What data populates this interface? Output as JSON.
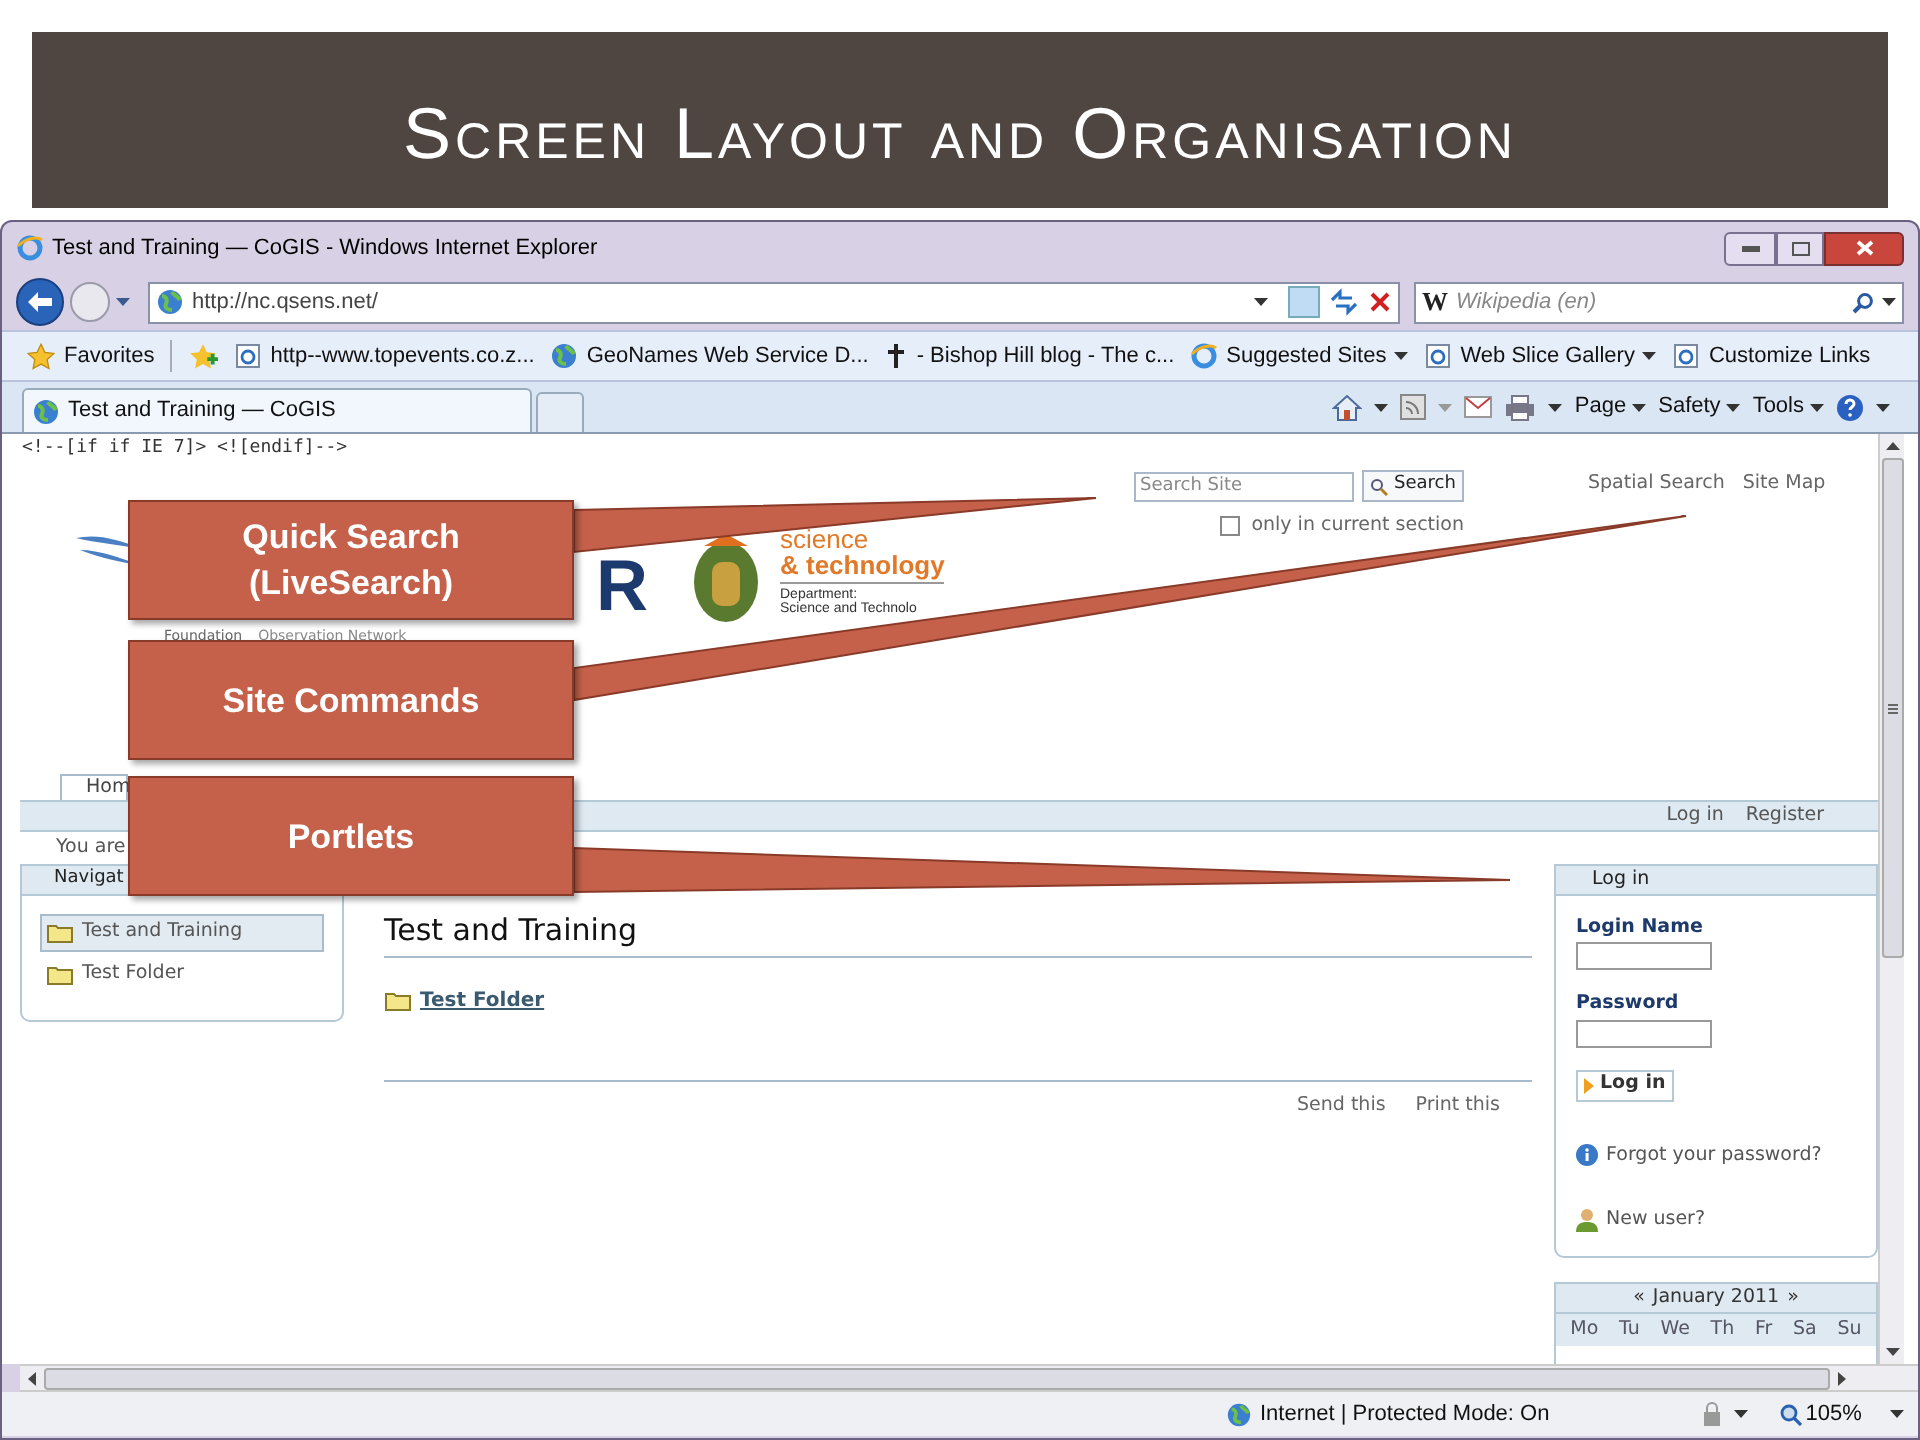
{
  "slide": {
    "title": "Screen Layout and Organisation"
  },
  "browser": {
    "title": "Test and Training — CoGIS - Windows Internet Explorer",
    "address": "http://nc.qsens.net/",
    "search_prefix": "W",
    "search_placeholder": "Wikipedia (en)",
    "favorites": [
      {
        "label": "Favorites",
        "kind": "star",
        "dropdown": false
      },
      {
        "label": "http--www.topevents.co.z...",
        "kind": "page",
        "dropdown": false
      },
      {
        "label": "GeoNames Web Service D...",
        "kind": "globe",
        "dropdown": false
      },
      {
        "label": "- Bishop Hill blog - The c...",
        "kind": "cross",
        "dropdown": false
      },
      {
        "label": "Suggested Sites",
        "kind": "ie",
        "dropdown": true
      },
      {
        "label": "Web Slice Gallery",
        "kind": "page",
        "dropdown": true
      },
      {
        "label": "Customize Links",
        "kind": "page",
        "dropdown": false
      }
    ],
    "tab": "Test and Training — CoGIS",
    "commands": [
      "Page",
      "Safety",
      "Tools"
    ],
    "status": "Internet | Protected Mode: On",
    "zoom": "105%"
  },
  "page": {
    "comment": "<!--[if if IE 7]> <![endif]-->",
    "logos": {
      "letter": "R",
      "science": "science",
      "technology": "& technology",
      "department": "Department:",
      "department_name": "Science and Technolo",
      "foundation": "Foundation",
      "network": "Observation Network"
    },
    "search": {
      "placeholder": "Search Site",
      "button": "Search",
      "scope": "only in current section",
      "scope_checked": false
    },
    "site_actions": [
      "Spatial Search",
      "Site Map"
    ],
    "tab": "Hom",
    "personal": [
      "Log in",
      "Register"
    ],
    "breadcrumb": "You are",
    "nav": {
      "title": "Navigat",
      "items": [
        {
          "label": "Test and Training",
          "selected": true
        },
        {
          "label": "Test Folder",
          "selected": false
        }
      ]
    },
    "content": {
      "heading": "Test and Training",
      "items": [
        "Test Folder"
      ],
      "actions": [
        "Send this",
        "Print this"
      ]
    },
    "login": {
      "title": "Log in",
      "name_label": "Login Name",
      "password_label": "Password",
      "button": "Log in",
      "forgot": "Forgot your password?",
      "new_user": "New user?"
    },
    "calendar": {
      "prev": "«",
      "month": "January 2011",
      "next": "»",
      "days": [
        "Mo",
        "Tu",
        "We",
        "Th",
        "Fr",
        "Sa",
        "Su"
      ]
    }
  },
  "callouts": [
    {
      "label": "Quick Search (LiveSearch)"
    },
    {
      "label": "Site Commands"
    },
    {
      "label": "Portlets"
    }
  ]
}
